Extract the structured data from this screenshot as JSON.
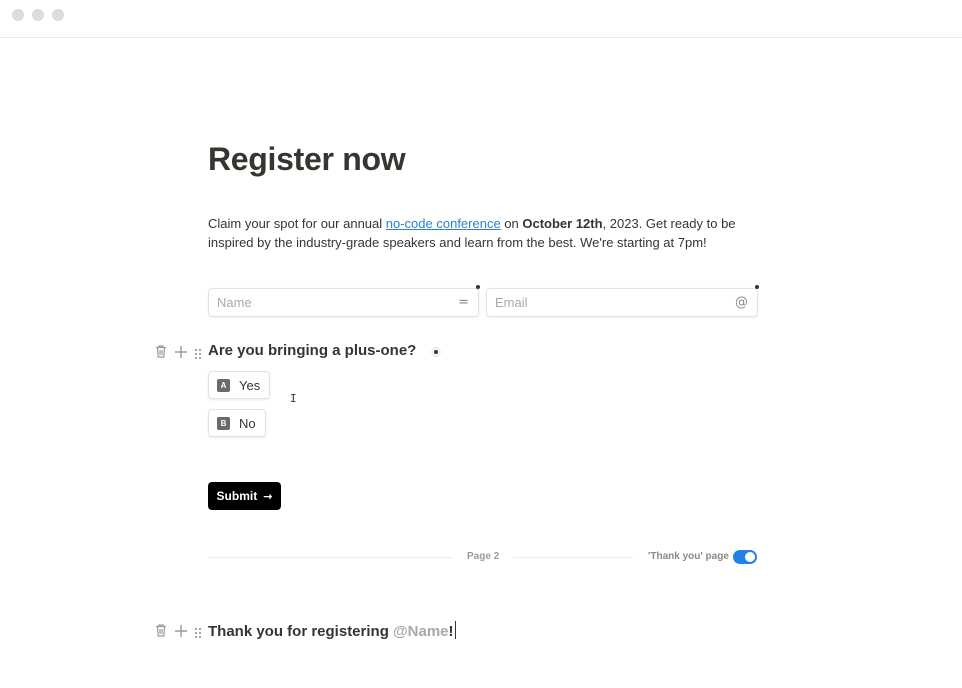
{
  "form": {
    "title": "Register now",
    "description": {
      "part1": "Claim your spot for our annual ",
      "link": "no-code conference",
      "part2": " on ",
      "bold": "October 12th",
      "part3": ", 2023. Get ready to be inspired by the industry-grade speakers and learn from the best. We're starting at 7pm!"
    },
    "fields": {
      "name_placeholder": "Name",
      "name_icon": "=",
      "email_placeholder": "Email",
      "email_icon": "@"
    },
    "question": {
      "text": "Are you bringing a plus-one?",
      "options": [
        {
          "key": "A",
          "label": "Yes"
        },
        {
          "key": "B",
          "label": "No"
        }
      ]
    },
    "submit_label": "Submit"
  },
  "page_divider": {
    "label": "Page 2",
    "thank_you_label": "'Thank you' page",
    "thank_you_enabled": true
  },
  "thank_you": {
    "text": "Thank you for registering ",
    "mention": "@Name",
    "suffix": "!"
  },
  "colors": {
    "link": "#2f80d1",
    "toggle_on": "#2383e2",
    "submit_bg": "#000000",
    "text": "#37352f"
  },
  "icons": {
    "block_actions": [
      "trash-icon",
      "plus-icon",
      "drag-handle-icon"
    ]
  }
}
